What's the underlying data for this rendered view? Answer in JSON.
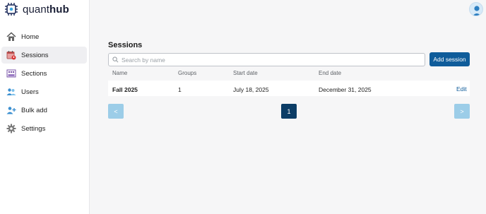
{
  "app": {
    "logo_light": "quant",
    "logo_bold": "hub"
  },
  "sidebar": {
    "items": [
      {
        "label": "Home",
        "icon": "home-icon"
      },
      {
        "label": "Sessions",
        "icon": "calendar-icon"
      },
      {
        "label": "Sections",
        "icon": "sections-icon"
      },
      {
        "label": "Users",
        "icon": "users-icon"
      },
      {
        "label": "Bulk add",
        "icon": "add-user-icon"
      },
      {
        "label": "Settings",
        "icon": "gear-icon"
      }
    ],
    "active": "Sessions"
  },
  "main": {
    "title": "Sessions",
    "search_placeholder": "Search by name",
    "add_button": "Add session",
    "columns": [
      "Name",
      "Groups",
      "Start date",
      "End date"
    ],
    "rows": [
      {
        "name": "Fall 2025",
        "groups": "1",
        "start": "July 18, 2025",
        "end": "December 31, 2025",
        "action": "Edit"
      }
    ]
  },
  "pagination": {
    "prev": "<",
    "current": "1",
    "next": ">"
  },
  "colors": {
    "primary": "#0f5c9a",
    "pager_dark": "#0c3d66",
    "pager_light": "#9ccde8"
  }
}
